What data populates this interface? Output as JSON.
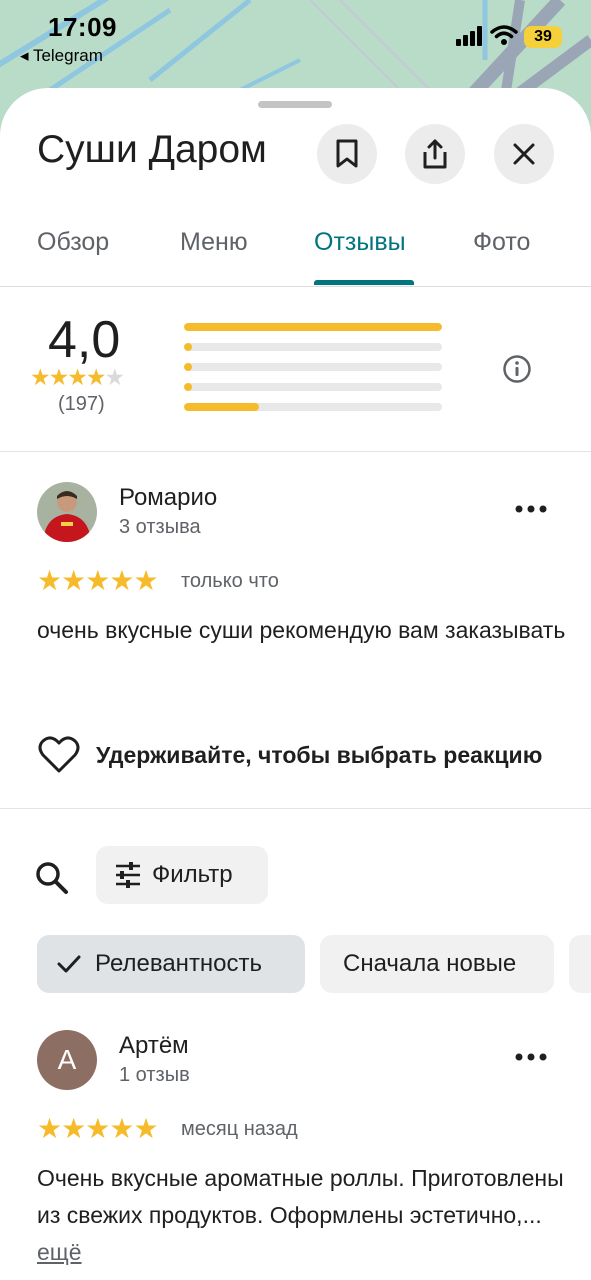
{
  "status_bar": {
    "time": "17:09",
    "back_app": "◂ Telegram",
    "battery": "39"
  },
  "place": {
    "title": "Суши Даром"
  },
  "actions": {
    "bookmark_icon": "bookmark-icon",
    "share_icon": "share-icon",
    "close_icon": "close-icon"
  },
  "tabs": [
    {
      "label": "Обзор",
      "active": false
    },
    {
      "label": "Меню",
      "active": false
    },
    {
      "label": "Отзывы",
      "active": true
    },
    {
      "label": "Фото",
      "active": false
    }
  ],
  "rating_summary": {
    "rating": "4,0",
    "stars_filled": 4,
    "count": "(197)",
    "distribution": [
      {
        "stars": 5,
        "fraction": 1.0
      },
      {
        "stars": 4,
        "fraction": 0.03
      },
      {
        "stars": 3,
        "fraction": 0.01
      },
      {
        "stars": 2,
        "fraction": 0.03
      },
      {
        "stars": 1,
        "fraction": 0.29
      }
    ]
  },
  "reviews": [
    {
      "name": "Ромарио",
      "sub": "3 отзыва",
      "stars": 5,
      "time": "только что",
      "text": "очень вкусные суши рекомендую вам заказывать",
      "reaction_label": "Удерживайте, чтобы выбрать реакцию"
    },
    {
      "name": "Артём",
      "avatar_letter": "А",
      "sub": "1 отзыв",
      "stars": 5,
      "time": "месяц назад",
      "text": "Очень вкусные ароматные роллы. Приготовлены из свежих продуктов. Оформлены эстетично,...",
      "more_label": "ещё"
    }
  ],
  "filters": {
    "filter_label": "Фильтр",
    "chips": [
      {
        "label": "Релевантность",
        "selected": true
      },
      {
        "label": "Сначала новые",
        "selected": false
      }
    ]
  },
  "colors": {
    "accent": "#00747f",
    "star": "#f6bb2a",
    "map": "#b9dcc8"
  }
}
